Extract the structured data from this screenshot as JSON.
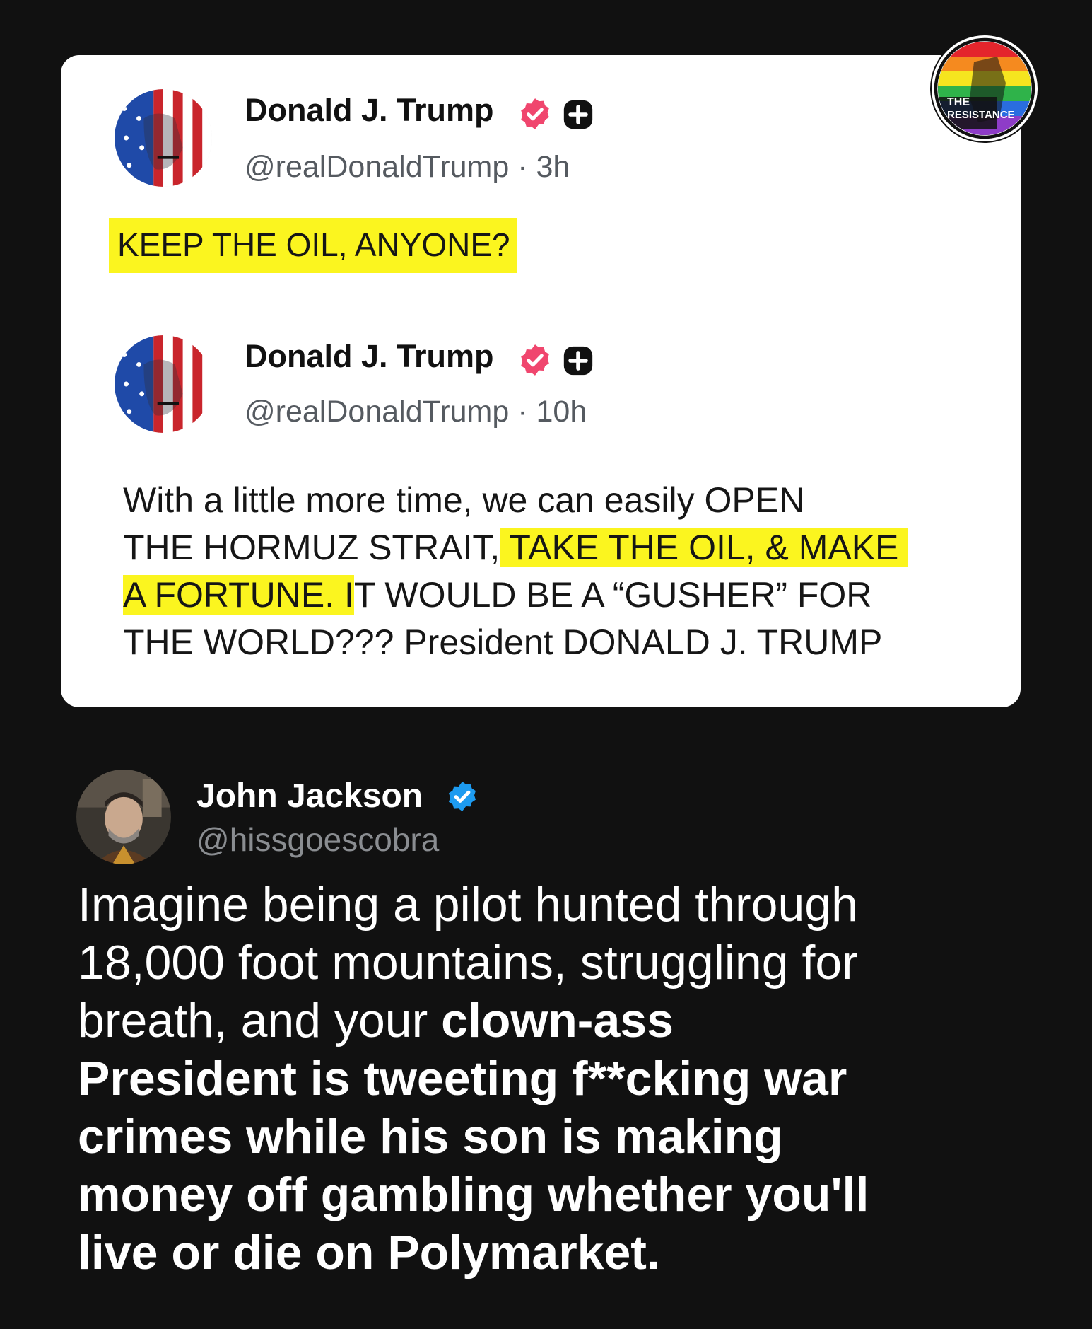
{
  "screenshot_card": {
    "post1": {
      "author_name": "Donald J. Trump",
      "handle": "@realDonaldTrump",
      "separator": "·",
      "time": "3h",
      "text": "KEEP THE OIL, ANYONE?"
    },
    "post2": {
      "author_name": "Donald J. Trump",
      "handle": "@realDonaldTrump",
      "separator": "·",
      "time": "10h",
      "lines": {
        "l1": "With a little more time, we can easily OPEN",
        "l2a": "THE HORMUZ STRAIT,",
        "l2b": " TAKE THE OIL, & MAKE ",
        "l3a": "A FORTUNE. I",
        "l3b": "T WOULD BE A “GUSHER” FOR",
        "l4": "THE WORLD??? President DONALD J. TRUMP"
      }
    },
    "watermark": {
      "line1": "THE",
      "line2": "RESISTANCE"
    }
  },
  "tweet": {
    "author_name": "John Jackson",
    "handle": "@hissgoescobra",
    "lines": {
      "l1": "Imagine being a pilot hunted through",
      "l2": "18,000 foot mountains, struggling for",
      "l3a": "breath, and your ",
      "l3b": "clown-ass",
      "l4": "President is tweeting f**cking war",
      "l5": "crimes while his son is making",
      "l6": "money off gambling whether you'll",
      "l7": "live or die on Polymarket."
    }
  },
  "colors": {
    "background": "#111111",
    "card": "#ffffff",
    "highlight": "#fbf51f",
    "truth_badge": "#f0466e",
    "x_verified": "#1d9bf0"
  },
  "icons": [
    "verified-badge-icon",
    "plus-icon",
    "resistance-logo",
    "avatar"
  ]
}
